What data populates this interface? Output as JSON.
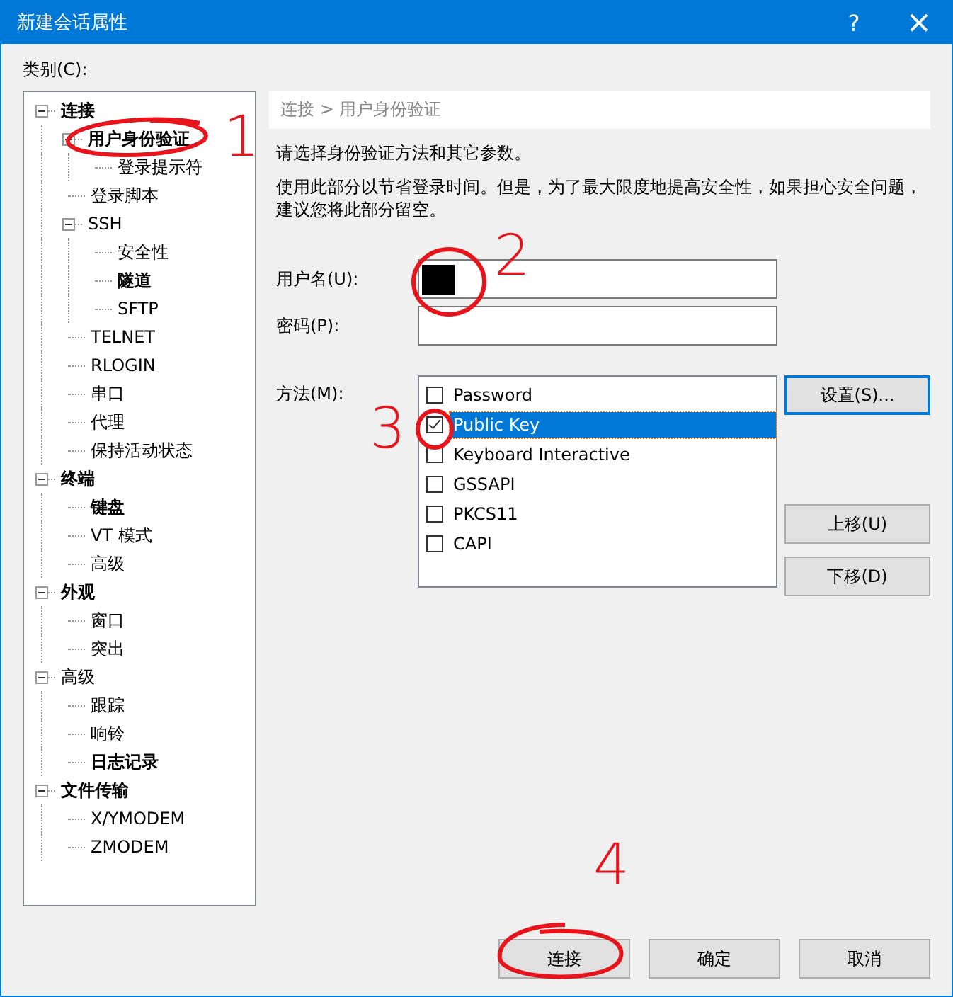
{
  "window": {
    "title": "新建会话属性",
    "help": "?",
    "close": "×"
  },
  "category_label": "类别(C):",
  "tree": [
    {
      "label": "连接",
      "bold": true,
      "expanded": true,
      "children": [
        {
          "label": "用户身份验证",
          "bold": true,
          "expanded": true,
          "children": [
            {
              "label": "登录提示符",
              "bold": false
            }
          ]
        },
        {
          "label": "登录脚本",
          "bold": false
        },
        {
          "label": "SSH",
          "bold": false,
          "expanded": true,
          "children": [
            {
              "label": "安全性",
              "bold": false
            },
            {
              "label": "隧道",
              "bold": true
            },
            {
              "label": "SFTP",
              "bold": false
            }
          ]
        },
        {
          "label": "TELNET",
          "bold": false
        },
        {
          "label": "RLOGIN",
          "bold": false
        },
        {
          "label": "串口",
          "bold": false
        },
        {
          "label": "代理",
          "bold": false
        },
        {
          "label": "保持活动状态",
          "bold": false
        }
      ]
    },
    {
      "label": "终端",
      "bold": true,
      "expanded": true,
      "children": [
        {
          "label": "键盘",
          "bold": true
        },
        {
          "label": "VT 模式",
          "bold": false
        },
        {
          "label": "高级",
          "bold": false
        }
      ]
    },
    {
      "label": "外观",
      "bold": true,
      "expanded": true,
      "children": [
        {
          "label": "窗口",
          "bold": false
        },
        {
          "label": "突出",
          "bold": false
        }
      ]
    },
    {
      "label": "高级",
      "bold": false,
      "expanded": true,
      "children": [
        {
          "label": "跟踪",
          "bold": false
        },
        {
          "label": "响铃",
          "bold": false
        },
        {
          "label": "日志记录",
          "bold": true
        }
      ]
    },
    {
      "label": "文件传输",
      "bold": true,
      "expanded": true,
      "children": [
        {
          "label": "X/YMODEM",
          "bold": false
        },
        {
          "label": "ZMODEM",
          "bold": false
        }
      ]
    }
  ],
  "breadcrumb": "连接 > 用户身份验证",
  "intro": "请选择身份验证方法和其它参数。",
  "note": "使用此部分以节省登录时间。但是，为了最大限度地提高安全性，如果担心安全问题，建议您将此部分留空。",
  "username": {
    "label": "用户名(U):",
    "redacted": true
  },
  "password": {
    "label": "密码(P):"
  },
  "method_label": "方法(M):",
  "methods": [
    {
      "label": "Password",
      "checked": false,
      "selected": false
    },
    {
      "label": "Public Key",
      "checked": true,
      "selected": true
    },
    {
      "label": "Keyboard Interactive",
      "checked": false,
      "selected": false
    },
    {
      "label": "GSSAPI",
      "checked": false,
      "selected": false
    },
    {
      "label": "PKCS11",
      "checked": false,
      "selected": false
    },
    {
      "label": "CAPI",
      "checked": false,
      "selected": false
    }
  ],
  "settings_button": "设置(S)...",
  "move_buttons": [
    "上移(U)",
    "下移(D)"
  ],
  "footer_buttons": [
    "连接",
    "确定",
    "取消"
  ],
  "annotations": [
    {
      "label": "1"
    },
    {
      "label": "2"
    },
    {
      "label": "3"
    },
    {
      "label": "4"
    }
  ]
}
